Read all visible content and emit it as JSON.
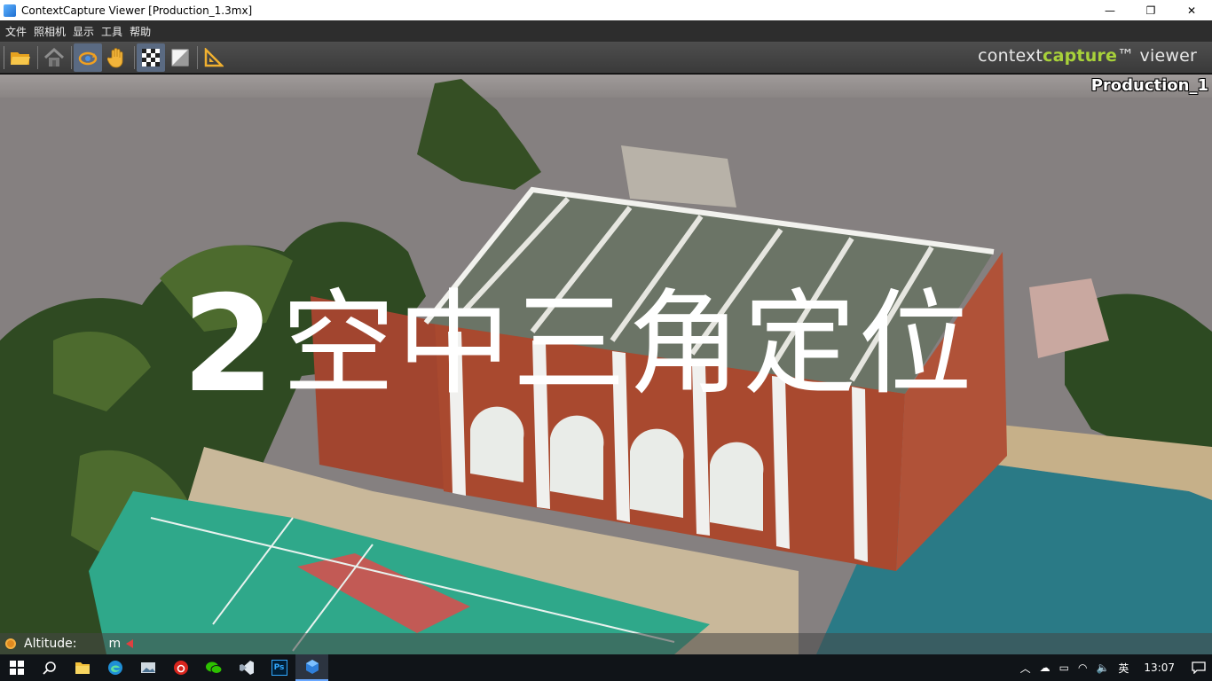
{
  "window": {
    "title": "ContextCapture Viewer [Production_1.3mx]",
    "minimize": "—",
    "maximize": "❐",
    "close": "✕"
  },
  "menu": {
    "items": [
      "文件",
      "照相机",
      "显示",
      "工具",
      "帮助"
    ]
  },
  "toolbar": {
    "buttons": [
      "open-folder-icon",
      "home-view-icon",
      "orbit-icon",
      "pan-hand-icon",
      "checker-texture-icon",
      "shading-icon",
      "measure-icon"
    ],
    "active": [
      "orbit-icon",
      "checker-texture-icon"
    ],
    "brand_pre": "context",
    "brand_cap": "capture",
    "brand_post": "™ viewer"
  },
  "viewport": {
    "production_name": "Production_1",
    "overlay_number": "2",
    "overlay_text": "空中三角定位"
  },
  "status": {
    "label": "Altitude:",
    "unit": "m"
  },
  "taskbar": {
    "apps": [
      "windows-start-icon",
      "search-icon",
      "file-explorer-icon",
      "edge-browser-icon",
      "photo-app-icon",
      "netease-music-icon",
      "wechat-icon",
      "vscode-icon",
      "photoshop-icon",
      "contextcapture-icon"
    ],
    "ps_label": "Ps",
    "ime": "英",
    "time": "13:07"
  },
  "colors": {
    "brand_accent": "#a8d13a",
    "sky": "#858080",
    "court": "#2fa88a",
    "brick": "#a2452f",
    "pool": "#2a7a86"
  }
}
